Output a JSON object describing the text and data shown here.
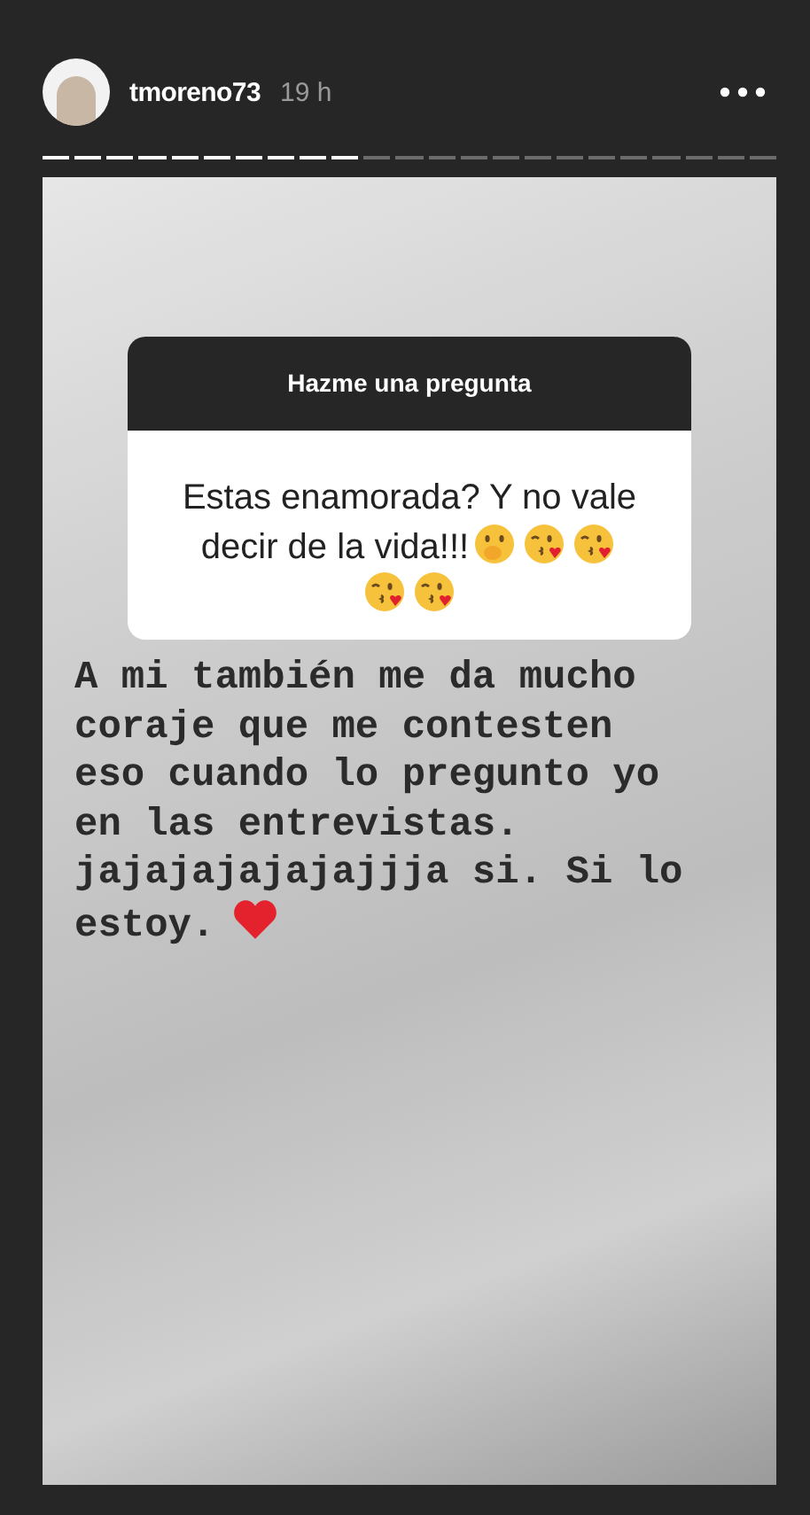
{
  "header": {
    "username": "tmoreno73",
    "time": "19 h"
  },
  "progress": [
    {
      "seen": true
    },
    {
      "seen": true
    },
    {
      "seen": true
    },
    {
      "seen": true
    },
    {
      "seen": true
    },
    {
      "seen": true
    },
    {
      "seen": true
    },
    {
      "seen": true
    },
    {
      "seen": true
    },
    {
      "seen": true
    },
    {
      "seen": false
    },
    {
      "seen": false
    },
    {
      "seen": false
    },
    {
      "seen": false
    },
    {
      "seen": false
    },
    {
      "seen": false
    },
    {
      "seen": false
    },
    {
      "seen": false
    },
    {
      "seen": false
    },
    {
      "seen": false
    },
    {
      "seen": false
    },
    {
      "seen": false
    },
    {
      "seen": false
    }
  ],
  "question_card": {
    "title": "Hazme una pregunta",
    "lines": [
      {
        "text": "Estas enamorada? Y no vale"
      },
      {
        "text": "decir de la vida!!!",
        "emojis": [
          {
            "kind": "shush"
          },
          {
            "kind": "kiss"
          },
          {
            "kind": "kiss"
          }
        ]
      },
      {
        "emojis": [
          {
            "kind": "kiss"
          },
          {
            "kind": "kiss"
          }
        ]
      }
    ]
  },
  "answer": {
    "lines": [
      {
        "text": "A mi también me da mucho"
      },
      {
        "text": "coraje que me contesten"
      },
      {
        "text": "eso cuando lo pregunto yo"
      },
      {
        "text": "en las entrevistas."
      },
      {
        "text": "jajajajajajajjja si. Si lo"
      },
      {
        "text": "estoy.",
        "emojis": [
          {
            "kind": "heart"
          }
        ]
      }
    ]
  }
}
